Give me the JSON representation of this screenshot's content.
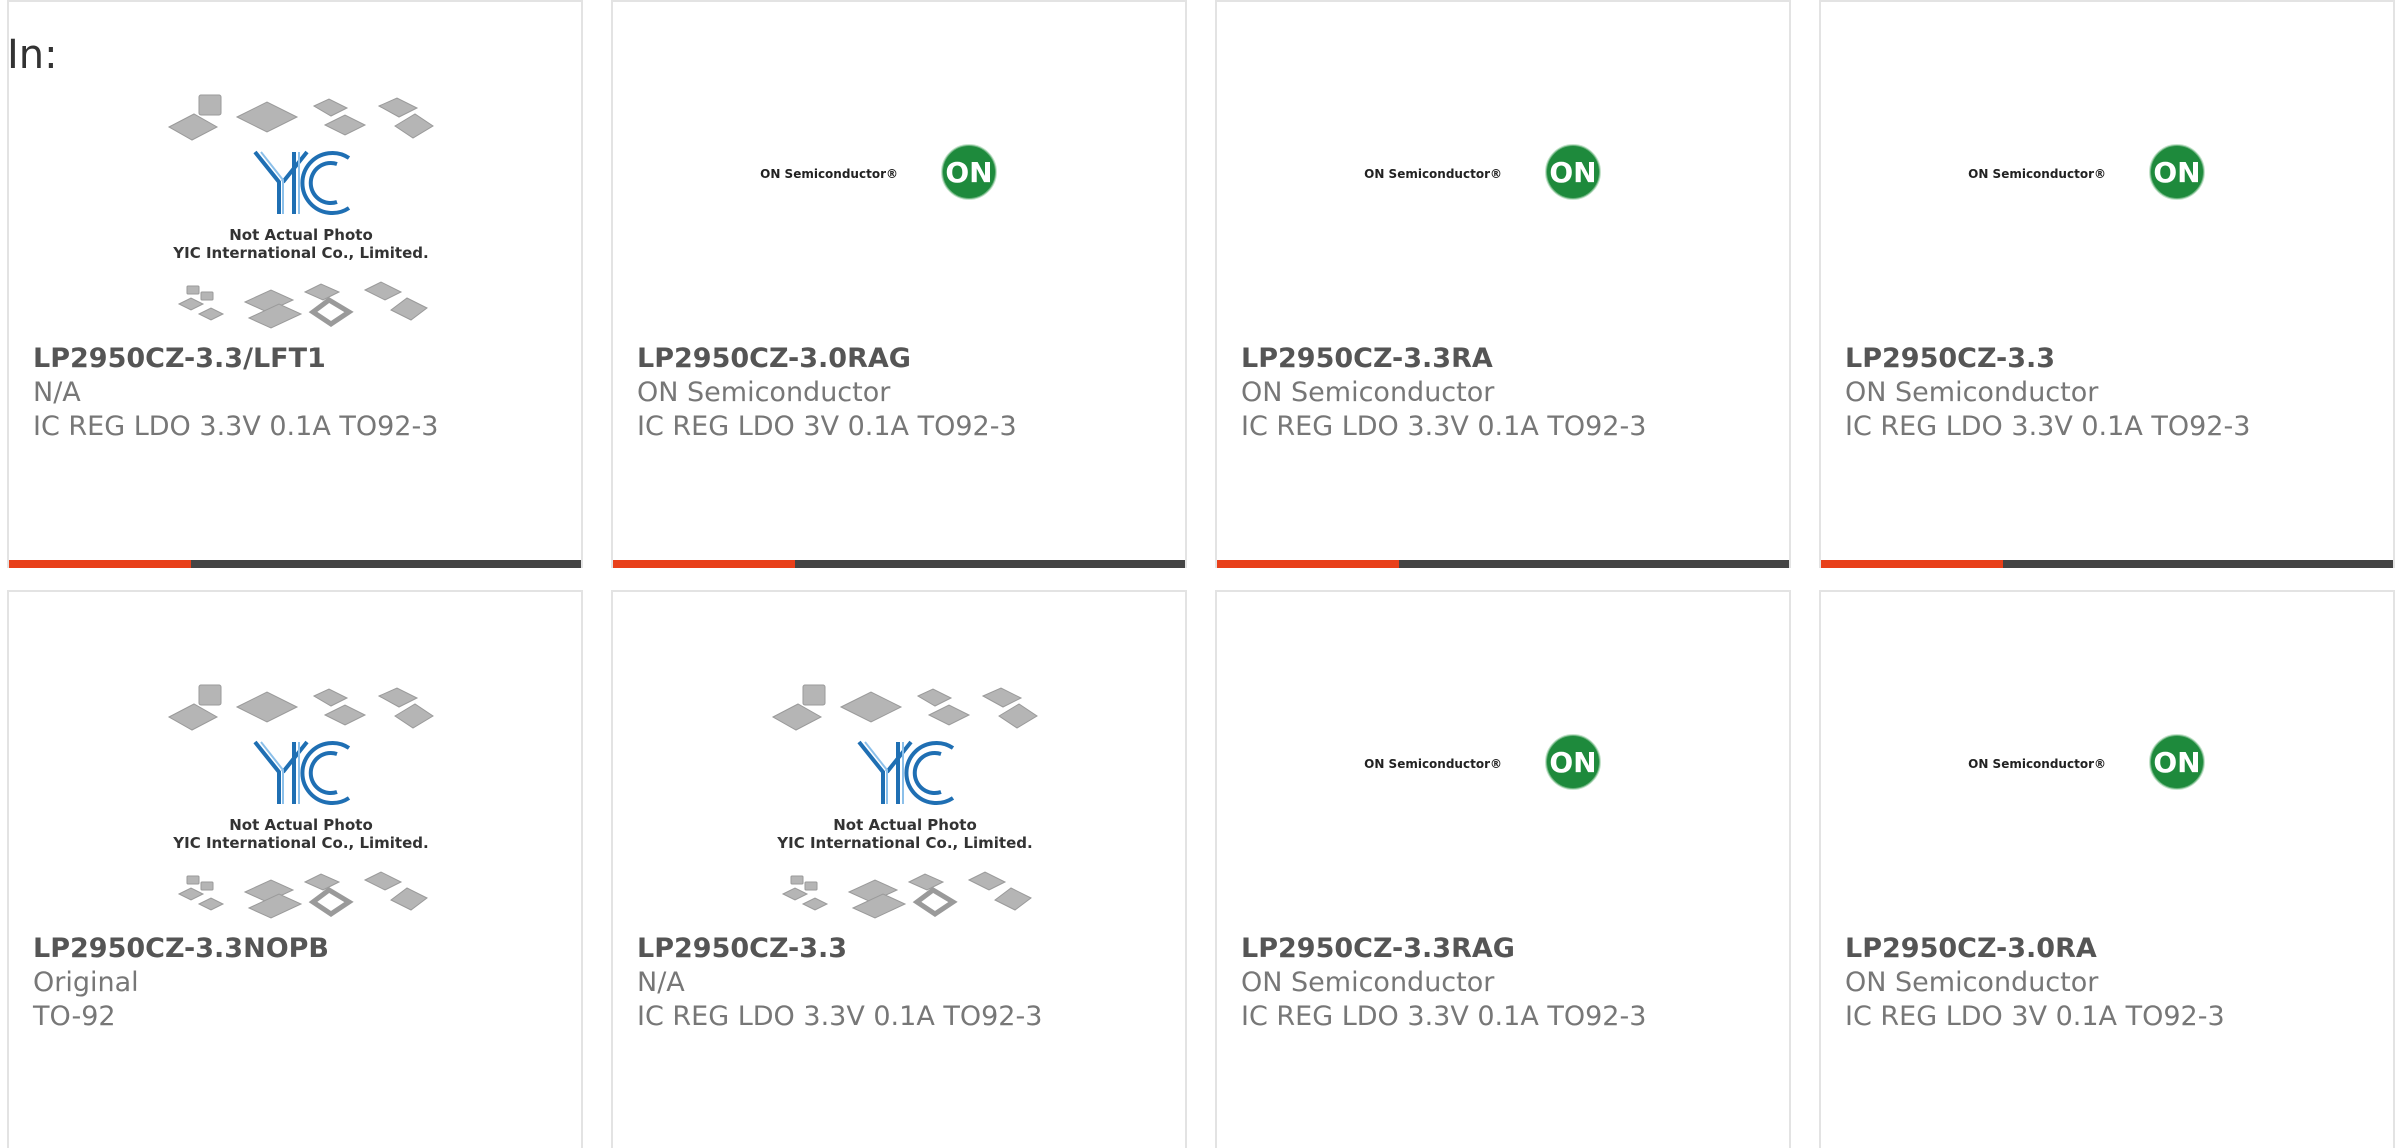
{
  "header": {
    "label": "In:"
  },
  "brand": {
    "on_logo_text": "ON Semiconductor",
    "on_badge": "ON",
    "yic_logo": "YIC",
    "yic_note": "Not Actual Photo",
    "yic_company": "YIC International Co., Limited."
  },
  "colors": {
    "accent": "#e8401a",
    "bar": "#444444",
    "on_green": "#1e8a3c"
  },
  "cards": [
    {
      "image": "yic-placeholder",
      "part": "LP2950CZ-3.3/LFT1",
      "manufacturer": "N/A",
      "description": "IC REG LDO 3.3V 0.1A TO92-3"
    },
    {
      "image": "on-semiconductor-logo",
      "part": "LP2950CZ-3.0RAG",
      "manufacturer": "ON Semiconductor",
      "description": "IC REG LDO 3V 0.1A TO92-3"
    },
    {
      "image": "on-semiconductor-logo",
      "part": "LP2950CZ-3.3RA",
      "manufacturer": "ON Semiconductor",
      "description": "IC REG LDO 3.3V 0.1A TO92-3"
    },
    {
      "image": "on-semiconductor-logo",
      "part": "LP2950CZ-3.3",
      "manufacturer": "ON Semiconductor",
      "description": "IC REG LDO 3.3V 0.1A TO92-3"
    },
    {
      "image": "yic-placeholder",
      "part": "LP2950CZ-3.3NOPB",
      "manufacturer": "Original",
      "description": "TO-92"
    },
    {
      "image": "yic-placeholder",
      "part": "LP2950CZ-3.3",
      "manufacturer": "N/A",
      "description": "IC REG LDO 3.3V 0.1A TO92-3"
    },
    {
      "image": "on-semiconductor-logo",
      "part": "LP2950CZ-3.3RAG",
      "manufacturer": "ON Semiconductor",
      "description": "IC REG LDO 3.3V 0.1A TO92-3"
    },
    {
      "image": "on-semiconductor-logo",
      "part": "LP2950CZ-3.0RA",
      "manufacturer": "ON Semiconductor",
      "description": "IC REG LDO 3V 0.1A TO92-3"
    }
  ]
}
